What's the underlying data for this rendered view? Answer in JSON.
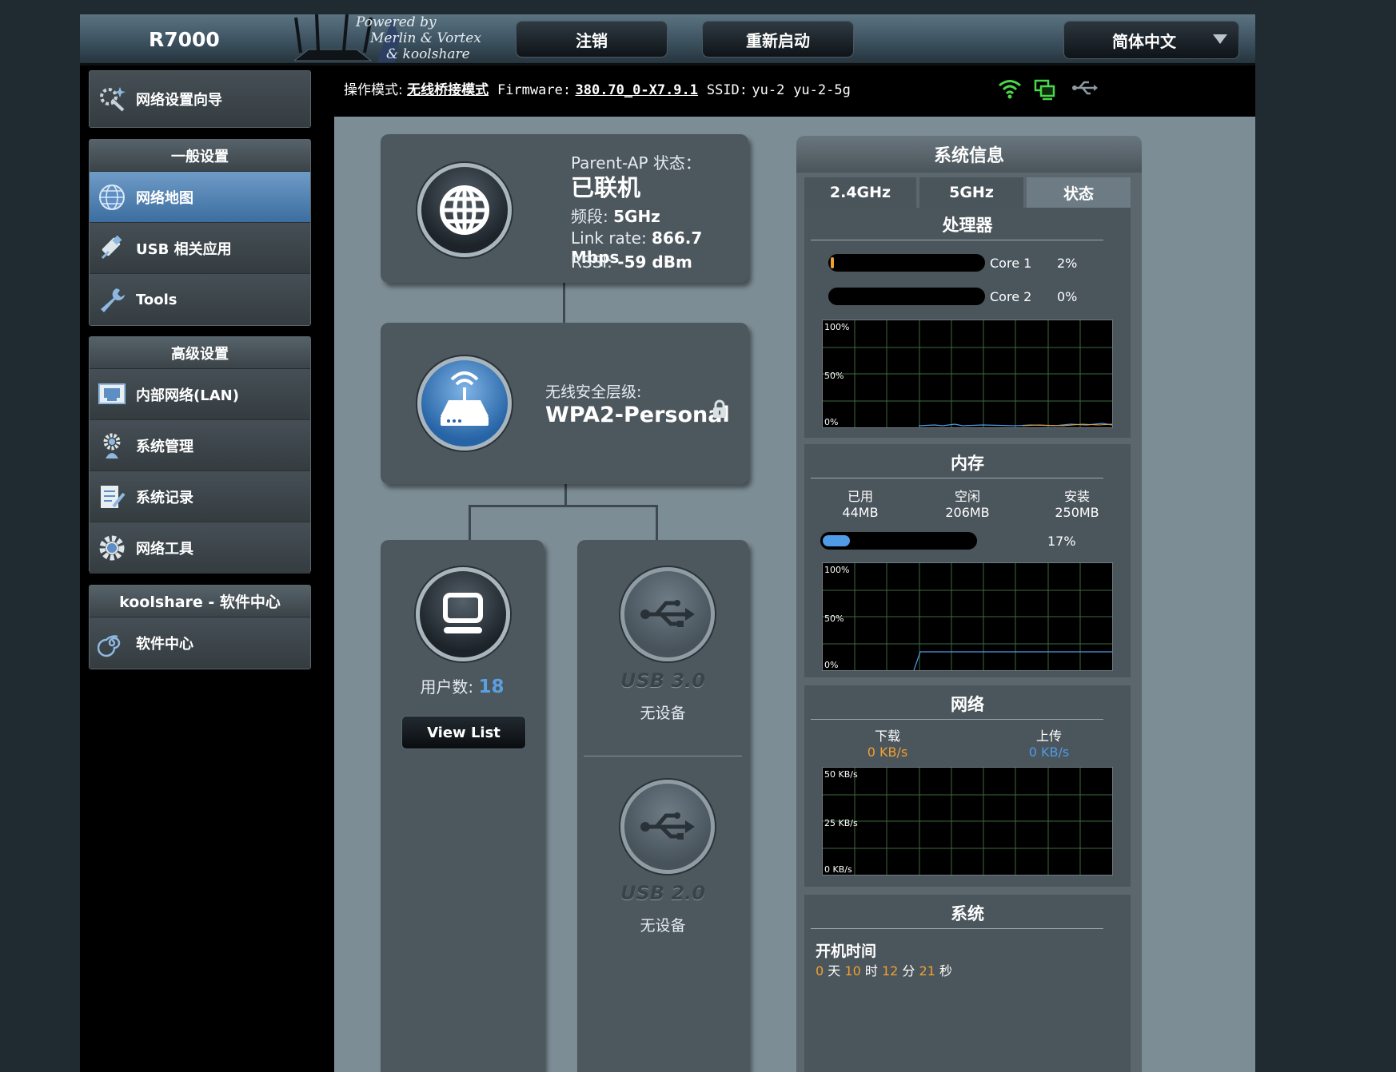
{
  "header": {
    "model": "R7000",
    "powered_lines": [
      "Powered by",
      "Merlin & Vortex",
      "& koolshare"
    ],
    "logout_label": "注销",
    "reboot_label": "重新启动",
    "language": "简体中文"
  },
  "infobar": {
    "mode_label": "操作模式:",
    "mode_value": "无线桥接模式",
    "firmware_label": "Firmware:",
    "firmware_value": "380.70_0-X7.9.1",
    "ssid_label": "SSID:",
    "ssid_1": "yu-2",
    "ssid_2": "yu-2-5g"
  },
  "sidebar": {
    "wizard": "网络设置向导",
    "general_header": "一般设置",
    "general_items": [
      "网络地图",
      "USB 相关应用",
      "Tools"
    ],
    "advanced_header": "高级设置",
    "advanced_items": [
      "内部网络(LAN)",
      "系统管理",
      "系统记录",
      "网络工具"
    ],
    "kool_header": "koolshare - 软件中心",
    "kool_items": [
      "软件中心"
    ]
  },
  "parent_ap": {
    "title": "Parent-AP 状态：",
    "status": "已联机",
    "band_label": "频段:",
    "band_value": "5GHz",
    "link_label": "Link rate:",
    "link_value": "866.7 Mbps",
    "rssi_label": "RSSI:",
    "rssi_value": "-59 dBm"
  },
  "security": {
    "label": "无线安全层级:",
    "value": "WPA2-Personal"
  },
  "clients": {
    "label": "用户数:",
    "count": "18",
    "button": "View List"
  },
  "usb3": {
    "name": "USB 3.0",
    "status": "无设备"
  },
  "usb2": {
    "name": "USB 2.0",
    "status": "无设备"
  },
  "sysinfo": {
    "title": "系统信息",
    "tabs": [
      "2.4GHz",
      "5GHz",
      "状态"
    ],
    "cpu": {
      "title": "处理器",
      "cores": [
        {
          "name": "Core 1",
          "percent": "2%",
          "value": 2
        },
        {
          "name": "Core 2",
          "percent": "0%",
          "value": 0
        }
      ],
      "graph_labels": [
        "100%",
        "50%",
        "0%"
      ]
    },
    "memory": {
      "title": "内存",
      "used_label": "已用",
      "used_value": "44MB",
      "free_label": "空闲",
      "free_value": "206MB",
      "total_label": "安装",
      "total_value": "250MB",
      "percent": "17%",
      "value": 17,
      "graph_labels": [
        "100%",
        "50%",
        "0%"
      ]
    },
    "network": {
      "title": "网络",
      "down_label": "下载",
      "down_value": "0 KB/s",
      "up_label": "上传",
      "up_value": "0 KB/s",
      "graph_labels": [
        "50 KB/s",
        "25 KB/s",
        "0 KB/s"
      ]
    },
    "system": {
      "title": "系统",
      "uptime_label": "开机时间",
      "days": "0",
      "days_unit": "天",
      "hours": "10",
      "hours_unit": "时",
      "minutes": "12",
      "minutes_unit": "分",
      "seconds": "21",
      "seconds_unit": "秒"
    }
  },
  "colors": {
    "accent_orange": "#f0a030",
    "accent_blue": "#4f9be6",
    "client_count": "#5aa0e0"
  }
}
